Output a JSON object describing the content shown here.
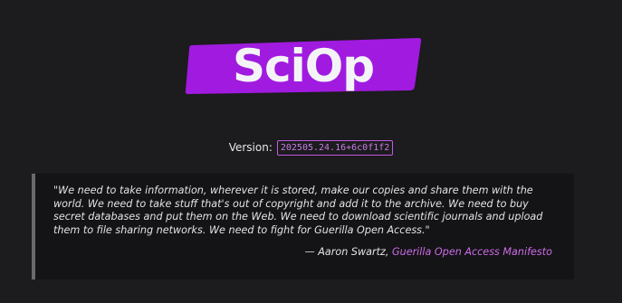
{
  "logo": {
    "text": "SciOp",
    "color": "#a01bdf"
  },
  "version": {
    "label": "Version:",
    "value": "202505.24.16+6c0f1f2"
  },
  "quote": {
    "text": "\"We need to take information, wherever it is stored, make our copies and share them with the world. We need to take stuff that's out of copyright and add it to the archive. We need to buy secret databases and put them on the Web. We need to download scientific journals and upload them to file sharing networks. We need to fight for Guerilla Open Access.\"",
    "attribution_prefix": "— Aaron Swartz, ",
    "source_link": "Guerilla Open Access Manifesto"
  },
  "colors": {
    "background": "#1c1b1d",
    "accent": "#c25ae2",
    "link": "#cd6de8"
  }
}
